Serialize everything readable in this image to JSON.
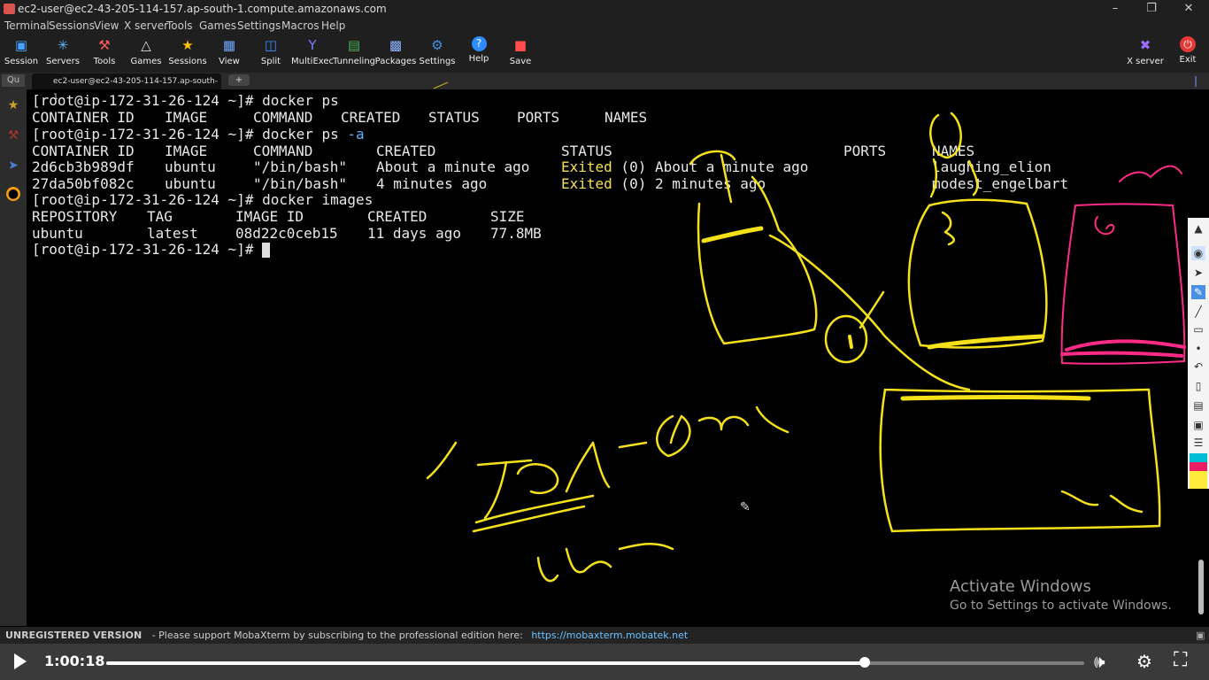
{
  "window": {
    "title": "ec2-user@ec2-43-205-114-157.ap-south-1.compute.amazonaws.com"
  },
  "menu": [
    "Terminal",
    "Sessions",
    "View",
    "X server",
    "Tools",
    "Games",
    "Settings",
    "Macros",
    "Help"
  ],
  "toolbar": [
    {
      "label": "Session",
      "icon": "session-icon",
      "color": "#4aa3ff"
    },
    {
      "label": "Servers",
      "icon": "servers-icon",
      "color": "#5fb3ff"
    },
    {
      "label": "Tools",
      "icon": "tools-icon",
      "color": "#ff5a5a"
    },
    {
      "label": "Games",
      "icon": "games-icon",
      "color": "#dddddd"
    },
    {
      "label": "Sessions",
      "icon": "star-icon",
      "color": "#ffc107"
    },
    {
      "label": "View",
      "icon": "view-icon",
      "color": "#6fa8ff"
    },
    {
      "label": "Split",
      "icon": "split-icon",
      "color": "#3f8cff"
    },
    {
      "label": "MultiExec",
      "icon": "multiexec-icon",
      "color": "#7b7bff"
    },
    {
      "label": "Tunneling",
      "icon": "tunneling-icon",
      "color": "#4caf50"
    },
    {
      "label": "Packages",
      "icon": "packages-icon",
      "color": "#8fb4ff"
    },
    {
      "label": "Settings",
      "icon": "settings-icon",
      "color": "#4a90e2"
    },
    {
      "label": "Help",
      "icon": "help-icon",
      "color": "#2d8cff"
    },
    {
      "label": "Save",
      "icon": "save-icon",
      "color": "#ff4d4d"
    }
  ],
  "toolbar_right": [
    {
      "label": "X server",
      "icon": "xserver-icon"
    },
    {
      "label": "Exit",
      "icon": "power-icon"
    }
  ],
  "tabs": {
    "quick": "Qu",
    "active": "ec2-user@ec2-43-205-114-157.ap-south-1",
    "new": "+"
  },
  "terminal": {
    "prompt": "[root@ip-172-31-26-124 ~]# ",
    "cmd1": "docker ps",
    "ps_header": [
      "CONTAINER ID",
      "IMAGE",
      "COMMAND",
      "CREATED",
      "STATUS",
      "PORTS",
      "NAMES"
    ],
    "cmd2_base": "docker ps ",
    "cmd2_flag": "-a",
    "psa_header": [
      "CONTAINER ID",
      "IMAGE",
      "COMMAND",
      "CREATED",
      "STATUS",
      "PORTS",
      "NAMES"
    ],
    "psa_rows": [
      {
        "id": "2d6cb3b989df",
        "image": "ubuntu",
        "command": "\"/bin/bash\"",
        "created": "About a minute ago",
        "exited": "Exited",
        "status_rest": " (0) About a minute ago",
        "ports": "",
        "names": "laughing_elion"
      },
      {
        "id": "27da50bf082c",
        "image": "ubuntu",
        "command": "\"/bin/bash\"",
        "created": "4 minutes ago",
        "exited": "Exited",
        "status_rest": " (0) 2 minutes ago",
        "ports": "",
        "names": "modest_engelbart"
      }
    ],
    "cmd3": "docker images",
    "img_header": [
      "REPOSITORY",
      "TAG",
      "IMAGE ID",
      "CREATED",
      "SIZE"
    ],
    "img_rows": [
      {
        "repository": "ubuntu",
        "tag": "latest",
        "image_id": "08d22c0ceb15",
        "created": "11 days ago",
        "size": "77.8MB"
      }
    ]
  },
  "watermark": {
    "line1": "Activate Windows",
    "line2": "Go to Settings to activate Windows."
  },
  "status": {
    "bold": "UNREGISTERED VERSION",
    "text": "-  Please support MobaXterm by subscribing to the professional edition here:",
    "link": "https://mobaxterm.mobatek.net"
  },
  "player": {
    "time": "1:00:18",
    "progress": 0.776
  },
  "colors": {
    "ink": "#f5e11a",
    "ink_pink": "#ff2b86",
    "exited": "#f3e055",
    "flag": "#5ab2ff",
    "link": "#6cc3ff"
  }
}
